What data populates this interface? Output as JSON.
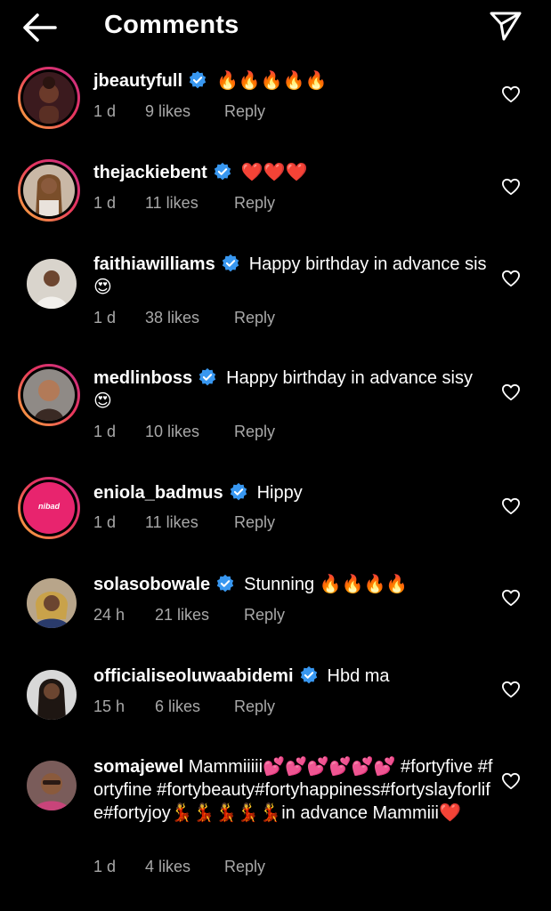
{
  "header": {
    "title": "Comments",
    "back_icon": "arrow-left-icon",
    "share_icon": "send-icon"
  },
  "actions": {
    "reply_label": "Reply"
  },
  "colors": {
    "background": "#000000",
    "verified": "#3897f0",
    "secondary_text": "#a8a8a8"
  },
  "comments": [
    {
      "username": "jbeautyfull",
      "verified": true,
      "text": "🔥🔥🔥🔥🔥",
      "time": "1 d",
      "likes": "9 likes"
    },
    {
      "username": "thejackiebent",
      "verified": true,
      "text": "❤️❤️❤️",
      "time": "1 d",
      "likes": "11 likes"
    },
    {
      "username": "faithiawilliams",
      "verified": true,
      "text": "Happy birthday in advance sis 😍",
      "time": "1 d",
      "likes": "38 likes"
    },
    {
      "username": "medlinboss",
      "verified": true,
      "text": "Happy birthday in advance sisy 😍",
      "time": "1 d",
      "likes": "10 likes"
    },
    {
      "username": "eniola_badmus",
      "verified": true,
      "text": "Hippy",
      "time": "1 d",
      "likes": "11 likes",
      "avatar_logo_text": "nibad"
    },
    {
      "username": "solasobowale",
      "verified": true,
      "text": "Stunning 🔥🔥🔥🔥",
      "time": "24 h",
      "likes": "21 likes"
    },
    {
      "username": "officialiseoluwaabidemi",
      "verified": true,
      "text": "Hbd ma",
      "time": "15 h",
      "likes": "6 likes"
    },
    {
      "username": "somajewel",
      "verified": false,
      "text": "Mammiiiii💕💕💕💕💕💕 #fortyfive #fortyfine #fortybeauty#fortyhappiness#fortyslayforlife#fortyjoy💃💃💃💃💃in advance Mammiii❤️",
      "time": "1 d",
      "likes": "4 likes"
    }
  ]
}
